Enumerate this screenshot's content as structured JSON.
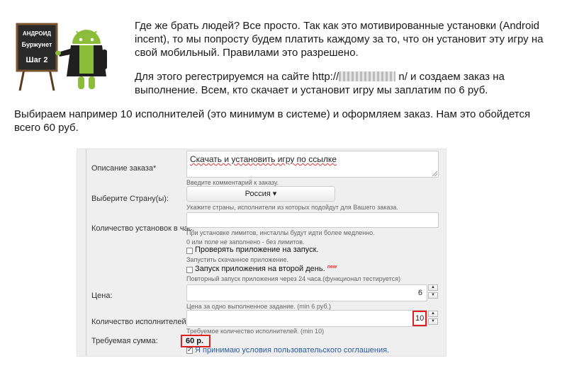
{
  "logo": {
    "line1": "АНДРОИД",
    "line2": "Буржунет",
    "line3": "Шаг 2"
  },
  "intro": {
    "p1": "Где же брать людей?  Все просто. Так как это мотивированные установки (Android incent), то мы попросту будем платить каждому за то, что он установит эту игру на свой мобильный. Правилами это разрешено.",
    "p2_before": "Для этого регестрируемся на сайте http://",
    "p2_after": "n/ и создаем заказ на выполнение. Всем, кто скачает и установит игру мы заплатим по 6 руб."
  },
  "summary": "Выбираем например 10 исполнителей (это минимум в системе) и оформляем заказ. Нам это обойдется всего 60 руб.",
  "form": {
    "description": {
      "label": "Описание заказа*",
      "value": "Скачать и установить игру по ссылке",
      "hint": "Введите комментарий к заказу."
    },
    "country": {
      "label": "Выберите Страну(ы):",
      "value": "Россия ▾",
      "hint": "Укажите страны, исполнители из которых подойдут для Вашего заказа."
    },
    "installs_per_hour": {
      "label": "Количество установок в час:",
      "value": "",
      "hint1": "При установке лимитов, инсталлы будут идти более медленно.",
      "hint2": "0 или поле не заполнено - без лимитов."
    },
    "check_launch": {
      "label": "Проверять приложение на запуск.",
      "hint": "Запустить скачанное приложение.",
      "checked": false
    },
    "second_day": {
      "label": "Запуск приложения на второй день.",
      "badge": "new",
      "hint": "Повторный запуск приложения через 24 часа.(функционал тестируется)",
      "checked": false
    },
    "price": {
      "label": "Цена:",
      "value": "6",
      "hint": "Цена за одно выполненное задание. (min 6 руб.)"
    },
    "performers": {
      "label": "Количество исполнителей:*",
      "value": "10",
      "hint": "Требуемое количество исполнителей. (min 10)"
    },
    "total": {
      "label": "Требуемая сумма:",
      "value": "60 р."
    },
    "agree": {
      "label": "Я принимаю условия пользовательского соглашения.",
      "checked": true
    },
    "spinner": {
      "up": "▲",
      "down": "▼"
    }
  },
  "colors": {
    "highlight": "#e02020",
    "link": "#2b5ea8",
    "android_green": "#8bbd3a"
  }
}
